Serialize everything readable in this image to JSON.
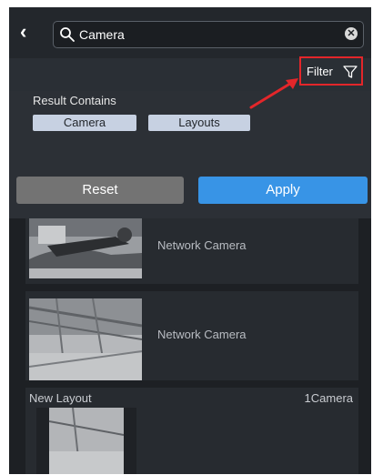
{
  "search": {
    "value": "Camera"
  },
  "filter": {
    "label": "Filter"
  },
  "panel": {
    "title": "Result Contains",
    "chips": [
      "Camera",
      "Layouts"
    ],
    "reset_label": "Reset",
    "apply_label": "Apply"
  },
  "results": {
    "items": [
      {
        "type": "Network Camera"
      },
      {
        "type": "Network Camera"
      }
    ],
    "layout": {
      "name": "New Layout",
      "count": "1Camera"
    }
  },
  "colors": {
    "highlight": "#e3262a",
    "apply": "#3894e6",
    "reset": "#737373",
    "chip": "#c7d1e2"
  },
  "icons": [
    "back-chevron-icon",
    "search-icon",
    "clear-icon",
    "filter-funnel-icon",
    "annotation-arrow"
  ]
}
